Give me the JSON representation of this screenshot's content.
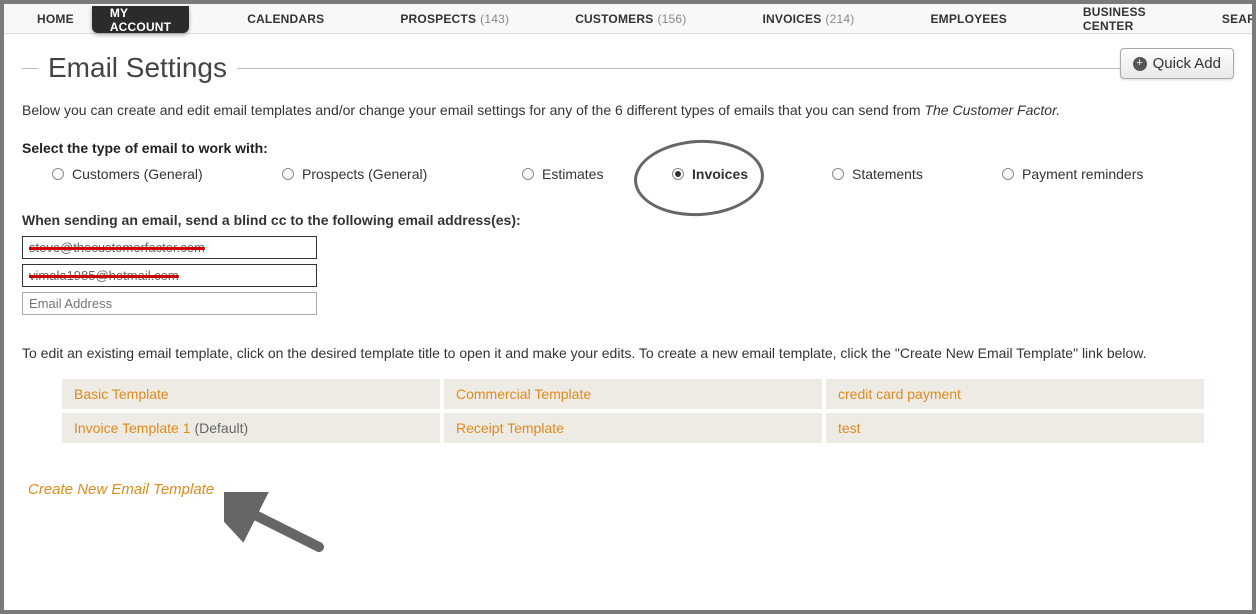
{
  "nav": {
    "items": [
      {
        "label": "HOME",
        "count": null,
        "active": false
      },
      {
        "label": "MY ACCOUNT",
        "count": null,
        "active": true
      },
      {
        "label": "CALENDARS",
        "count": null,
        "active": false
      },
      {
        "label": "PROSPECTS",
        "count": "(143)",
        "active": false
      },
      {
        "label": "CUSTOMERS",
        "count": "(156)",
        "active": false
      },
      {
        "label": "INVOICES",
        "count": "(214)",
        "active": false
      },
      {
        "label": "EMPLOYEES",
        "count": null,
        "active": false
      },
      {
        "label": "BUSINESS CENTER",
        "count": null,
        "active": false
      },
      {
        "label": "SEARCH",
        "count": null,
        "active": false
      }
    ]
  },
  "quick_add_label": "Quick Add",
  "page_title": "Email Settings",
  "intro_text": "Below you can create and edit email templates and/or change your email settings for any of the 6 different types of emails that you can send from ",
  "intro_brand": "The Customer Factor.",
  "select_label": "Select the type of email to work with:",
  "email_types": [
    {
      "label": "Customers (General)",
      "checked": false
    },
    {
      "label": "Prospects (General)",
      "checked": false
    },
    {
      "label": "Estimates",
      "checked": false
    },
    {
      "label": "Invoices",
      "checked": true
    },
    {
      "label": "Statements",
      "checked": false
    },
    {
      "label": "Payment reminders",
      "checked": false
    }
  ],
  "bcc_label": "When sending an email, send a blind cc to the following email address(es):",
  "bcc_inputs": [
    {
      "value": "steve@thecustomerfactor.com",
      "redacted": true
    },
    {
      "value": "vimala1985@hotmail.com",
      "redacted": true
    },
    {
      "value": "",
      "placeholder": "Email Address",
      "redacted": false
    }
  ],
  "template_note": "To edit an existing email template, click on the desired template title to open it and make your edits. To create a new email template, click the \"Create New Email Template\" link below.",
  "templates": [
    {
      "name": "Basic Template",
      "suffix": ""
    },
    {
      "name": "Commercial Template",
      "suffix": ""
    },
    {
      "name": "credit card payment",
      "suffix": ""
    },
    {
      "name": "Invoice Template 1",
      "suffix": "(Default)"
    },
    {
      "name": "Receipt Template",
      "suffix": ""
    },
    {
      "name": "test",
      "suffix": ""
    }
  ],
  "create_link": "Create New Email Template"
}
